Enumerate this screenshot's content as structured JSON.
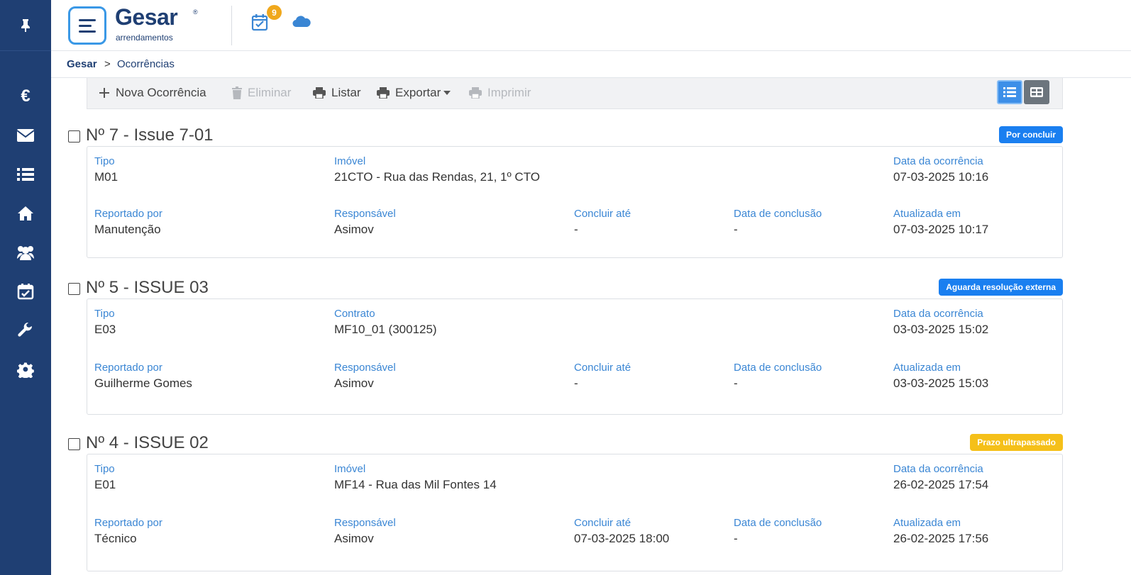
{
  "header": {
    "logo_text": "Gesar",
    "logo_reg": "®",
    "logo_sub": "arrendamentos",
    "notifications_count": "9"
  },
  "breadcrumb": {
    "root": "Gesar",
    "separator": ">",
    "current": "Ocorrências"
  },
  "toolbar": {
    "new_label": "Nova Ocorrência",
    "delete_label": "Eliminar",
    "list_label": "Listar",
    "export_label": "Exportar",
    "print_label": "Imprimir"
  },
  "colors": {
    "sidebar": "#1f3f73",
    "accent": "#3a86d4",
    "status_por_concluir": "#1a7ff0",
    "status_aguarda": "#1a7ff0",
    "status_prazo": "#f5c019"
  },
  "occurrences": [
    {
      "title": "Nº 7 - Issue 7-01",
      "status": "Por concluir",
      "tipo_label": "Tipo",
      "tipo": "M01",
      "ref_label": "Imóvel",
      "ref": "21CTO - Rua das Rendas, 21, 1º CTO",
      "data_ocorrencia_label": "Data da ocorrência",
      "data_ocorrencia": "07-03-2025 10:16",
      "reportado_label": "Reportado por",
      "reportado": "Manutenção",
      "responsavel_label": "Responsável",
      "responsavel": "Asimov",
      "concluir_ate_label": "Concluir até",
      "concluir_ate": "-",
      "data_conclusao_label": "Data de conclusão",
      "data_conclusao": "-",
      "atualizada_label": "Atualizada em",
      "atualizada": "07-03-2025 10:17"
    },
    {
      "title": "Nº 5 - ISSUE 03",
      "status": "Aguarda resolução externa",
      "tipo_label": "Tipo",
      "tipo": "E03",
      "ref_label": "Contrato",
      "ref": "MF10_01 (300125)",
      "data_ocorrencia_label": "Data da ocorrência",
      "data_ocorrencia": "03-03-2025 15:02",
      "reportado_label": "Reportado por",
      "reportado": "Guilherme Gomes",
      "responsavel_label": "Responsável",
      "responsavel": "Asimov",
      "concluir_ate_label": "Concluir até",
      "concluir_ate": "-",
      "data_conclusao_label": "Data de conclusão",
      "data_conclusao": "-",
      "atualizada_label": "Atualizada em",
      "atualizada": "03-03-2025 15:03"
    },
    {
      "title": "Nº 4 - ISSUE 02",
      "status": "Prazo ultrapassado",
      "tipo_label": "Tipo",
      "tipo": "E01",
      "ref_label": "Imóvel",
      "ref": "MF14 - Rua das Mil Fontes 14",
      "data_ocorrencia_label": "Data da ocorrência",
      "data_ocorrencia": "26-02-2025 17:54",
      "reportado_label": "Reportado por",
      "reportado": "Técnico",
      "responsavel_label": "Responsável",
      "responsavel": "Asimov",
      "concluir_ate_label": "Concluir até",
      "concluir_ate": "07-03-2025 18:00",
      "data_conclusao_label": "Data de conclusão",
      "data_conclusao": "-",
      "atualizada_label": "Atualizada em",
      "atualizada": "26-02-2025 17:56"
    }
  ]
}
